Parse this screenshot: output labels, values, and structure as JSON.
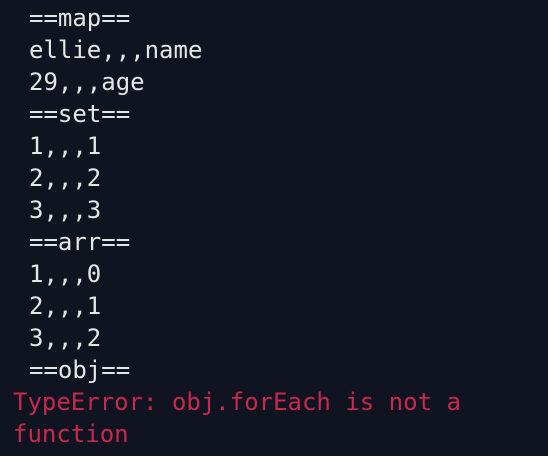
{
  "console": {
    "logs": [
      "==map==",
      "ellie,,,name",
      "29,,,age",
      "==set==",
      "1,,,1",
      "2,,,2",
      "3,,,3",
      "==arr==",
      "1,,,0",
      "2,,,1",
      "3,,,2",
      "==obj=="
    ],
    "error": {
      "line1": "TypeError: obj.forEach is not a",
      "line2": "function"
    }
  },
  "colors": {
    "background": "#0f1420",
    "log_text": "#e6e6e6",
    "error_text": "#c8284e"
  }
}
